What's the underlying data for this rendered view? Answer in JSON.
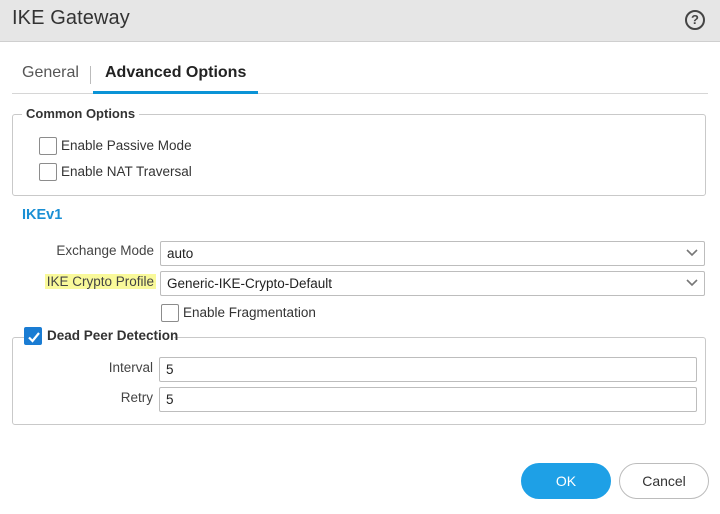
{
  "dialog": {
    "title": "IKE Gateway",
    "help_symbol": "?"
  },
  "tabs": [
    {
      "label": "General",
      "active": false
    },
    {
      "label": "Advanced Options",
      "active": true
    }
  ],
  "common_options": {
    "legend": "Common Options",
    "passive_mode": {
      "label": "Enable Passive Mode",
      "checked": false
    },
    "nat_traversal": {
      "label": "Enable NAT Traversal",
      "checked": false
    }
  },
  "ikev1": {
    "title": "IKEv1",
    "exchange_mode": {
      "label": "Exchange Mode",
      "value": "auto"
    },
    "crypto_profile": {
      "label": "IKE Crypto Profile",
      "value": "Generic-IKE-Crypto-Default"
    },
    "fragmentation": {
      "label": "Enable Fragmentation",
      "checked": false
    },
    "dpd": {
      "legend": "Dead Peer Detection",
      "checked": true,
      "interval": {
        "label": "Interval",
        "value": "5"
      },
      "retry": {
        "label": "Retry",
        "value": "5"
      }
    }
  },
  "buttons": {
    "ok": "OK",
    "cancel": "Cancel"
  },
  "colors": {
    "accent": "#1ea0e6",
    "section_title": "#1a8fd4",
    "highlight": "#f9f99a",
    "checkbox_checked": "#1a7cd3"
  }
}
